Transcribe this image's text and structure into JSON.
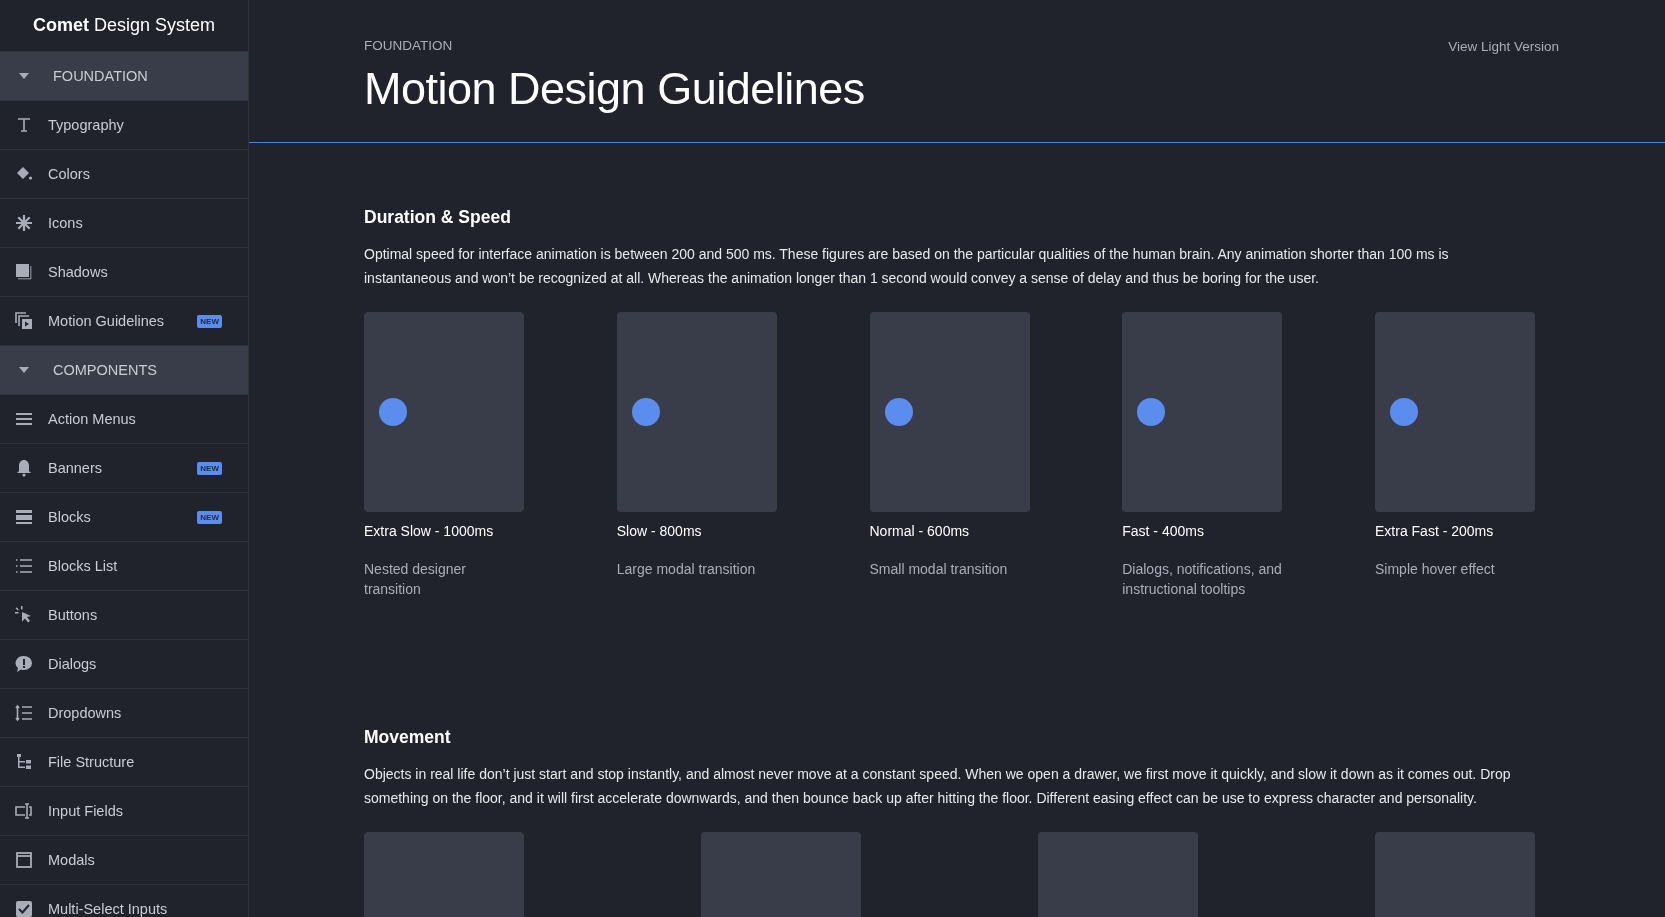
{
  "brand": {
    "bold": "Comet",
    "rest": "Design System"
  },
  "sidebar": {
    "items": [
      {
        "kind": "section",
        "label": "FOUNDATION",
        "expanded": true
      },
      {
        "kind": "link",
        "label": "Typography"
      },
      {
        "kind": "link",
        "label": "Colors"
      },
      {
        "kind": "link",
        "label": "Icons"
      },
      {
        "kind": "link",
        "label": "Shadows"
      },
      {
        "kind": "link",
        "label": "Motion Guidelines",
        "badge": "NEW"
      },
      {
        "kind": "section",
        "label": "COMPONENTS",
        "expanded": true
      },
      {
        "kind": "link",
        "label": "Action Menus"
      },
      {
        "kind": "link",
        "label": "Banners",
        "badge": "NEW"
      },
      {
        "kind": "link",
        "label": "Blocks",
        "badge": "NEW"
      },
      {
        "kind": "link",
        "label": "Blocks List"
      },
      {
        "kind": "link",
        "label": "Buttons"
      },
      {
        "kind": "link",
        "label": "Dialogs"
      },
      {
        "kind": "link",
        "label": "Dropdowns"
      },
      {
        "kind": "link",
        "label": "File Structure"
      },
      {
        "kind": "link",
        "label": "Input Fields"
      },
      {
        "kind": "link",
        "label": "Modals"
      },
      {
        "kind": "link",
        "label": "Multi-Select Inputs"
      }
    ]
  },
  "header": {
    "eyebrow": "FOUNDATION",
    "title": "Motion Design Guidelines",
    "action": "View Light Version"
  },
  "sections": [
    {
      "title": "Duration & Speed",
      "text": "Optimal speed for interface animation is between 200 and 500 ms. These figures are based on the particular qualities of the human brain. Any animation shorter than 100 ms is instantaneous and won’t be recognized at all. Whereas the animation longer than 1 second would convey a sense of delay and thus be boring for the user.",
      "cards": [
        {
          "kind": "demo",
          "label": "Extra Slow - 1000ms",
          "note": "Nested designer transition"
        },
        {
          "kind": "demo",
          "label": "Slow - 800ms",
          "note": "Large modal transition"
        },
        {
          "kind": "demo",
          "label": "Normal - 600ms",
          "note": "Small modal transition"
        },
        {
          "kind": "demo",
          "label": "Fast - 400ms",
          "note": "Dialogs, notifications, and instructional tooltips"
        },
        {
          "kind": "demo",
          "label": "Extra Fast - 200ms",
          "note": "Simple hover effect"
        }
      ]
    },
    {
      "title": "Movement",
      "text": "Objects in real life don’t just start and stop instantly, and almost never move at a constant speed. When we open a drawer, we first move it quickly, and slow it down as it comes out. Drop something on the floor, and it will first accelerate downwards, and then bounce back up after hitting the floor. Different easing effect can be use to express character and personality.",
      "cards": [
        {
          "kind": "blank"
        },
        {
          "kind": "blank"
        },
        {
          "kind": "blank"
        },
        {
          "kind": "blank"
        }
      ]
    }
  ]
}
